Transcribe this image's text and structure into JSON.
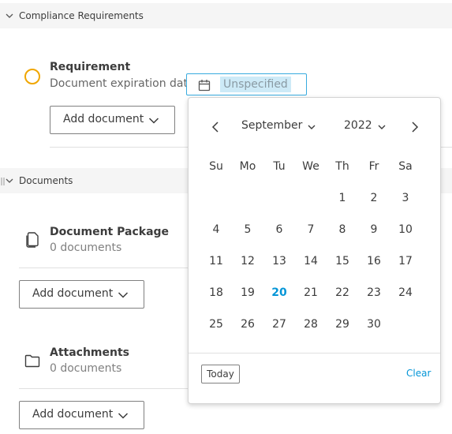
{
  "sections": {
    "compliance": {
      "title": "Compliance Requirements"
    },
    "documents": {
      "title": "Documents"
    }
  },
  "requirement": {
    "title": "Requirement",
    "label": "Document expiration date:",
    "date_value": "Unspecified",
    "add_label": "Add document"
  },
  "document_package": {
    "title": "Document Package",
    "count": "0 documents",
    "add_label": "Add document"
  },
  "attachments": {
    "title": "Attachments",
    "count": "0 documents",
    "add_label": "Add document"
  },
  "picker": {
    "month": "September",
    "year": "2022",
    "weekdays": [
      "Su",
      "Mo",
      "Tu",
      "We",
      "Th",
      "Fr",
      "Sa"
    ],
    "weeks": [
      [
        "",
        "",
        "",
        "",
        "1",
        "2",
        "3"
      ],
      [
        "4",
        "5",
        "6",
        "7",
        "8",
        "9",
        "10"
      ],
      [
        "11",
        "12",
        "13",
        "14",
        "15",
        "16",
        "17"
      ],
      [
        "18",
        "19",
        "20",
        "21",
        "22",
        "23",
        "24"
      ],
      [
        "25",
        "26",
        "27",
        "28",
        "29",
        "30",
        ""
      ]
    ],
    "highlighted_day": "20",
    "today_label": "Today",
    "clear_label": "Clear"
  },
  "colors": {
    "accent": "#0696d7",
    "status_circle": "#f0a600",
    "field_border": "#38abdf"
  }
}
